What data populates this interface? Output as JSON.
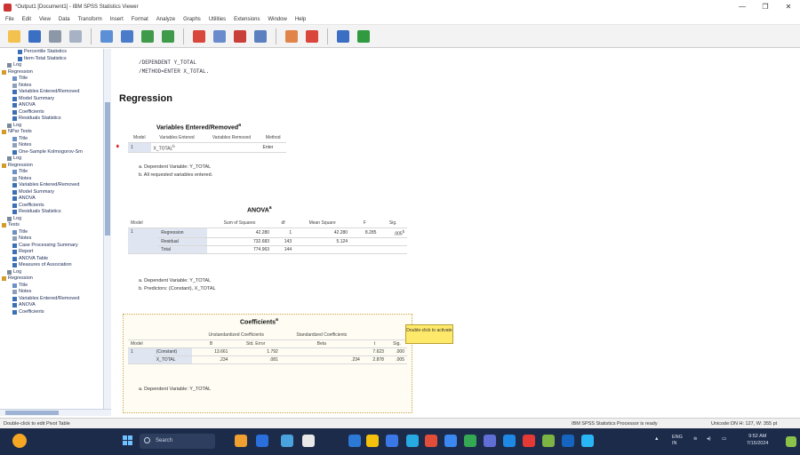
{
  "window": {
    "title": "*Output1 [Document1] - IBM SPSS Statistics Viewer",
    "controls": [
      "—",
      "❐",
      "✕"
    ]
  },
  "menu": [
    "File",
    "Edit",
    "View",
    "Data",
    "Transform",
    "Insert",
    "Format",
    "Analyze",
    "Graphs",
    "Utilities",
    "Extensions",
    "Window",
    "Help"
  ],
  "toolbar_icons": [
    "open-icon",
    "save-icon",
    "print-icon",
    "print-preview-icon",
    "export-icon",
    "recall-dialog-icon",
    "undo-icon",
    "redo-icon",
    "goto-data-icon",
    "goto-case-icon",
    "goto-variable-icon",
    "variables-icon",
    "designate-window-icon",
    "insert-output-icon",
    "promote-icon",
    "demote-icon",
    "collapse-icon",
    "expand-icon"
  ],
  "outline": {
    "nodes": [
      {
        "label": "Percentile Statistics",
        "indent": 3,
        "icon": "table"
      },
      {
        "label": "Item-Total Statistics",
        "indent": 3,
        "icon": "table"
      },
      {
        "label": "Log",
        "indent": 1,
        "icon": "log"
      },
      {
        "label": "Regression",
        "indent": 0,
        "icon": "book"
      },
      {
        "label": "Title",
        "indent": 2,
        "icon": "title"
      },
      {
        "label": "Notes",
        "indent": 2,
        "icon": "notes"
      },
      {
        "label": "Variables Entered/Removed",
        "indent": 2,
        "icon": "table"
      },
      {
        "label": "Model Summary",
        "indent": 2,
        "icon": "table"
      },
      {
        "label": "ANOVA",
        "indent": 2,
        "icon": "table"
      },
      {
        "label": "Coefficients",
        "indent": 2,
        "icon": "table"
      },
      {
        "label": "Residuals Statistics",
        "indent": 2,
        "icon": "table"
      },
      {
        "label": "Log",
        "indent": 1,
        "icon": "log"
      },
      {
        "label": "NPar Tests",
        "indent": 0,
        "icon": "book"
      },
      {
        "label": "Title",
        "indent": 2,
        "icon": "title"
      },
      {
        "label": "Notes",
        "indent": 2,
        "icon": "notes"
      },
      {
        "label": "One-Sample Kolmogorov-Sm",
        "indent": 2,
        "icon": "table"
      },
      {
        "label": "Log",
        "indent": 1,
        "icon": "log"
      },
      {
        "label": "Regression",
        "indent": 0,
        "icon": "book"
      },
      {
        "label": "Title",
        "indent": 2,
        "icon": "title"
      },
      {
        "label": "Notes",
        "indent": 2,
        "icon": "notes"
      },
      {
        "label": "Variables Entered/Removed",
        "indent": 2,
        "icon": "table"
      },
      {
        "label": "Model Summary",
        "indent": 2,
        "icon": "table"
      },
      {
        "label": "ANOVA",
        "indent": 2,
        "icon": "table"
      },
      {
        "label": "Coefficients",
        "indent": 2,
        "icon": "table"
      },
      {
        "label": "Residuals Statistics",
        "indent": 2,
        "icon": "table"
      },
      {
        "label": "Log",
        "indent": 1,
        "icon": "log"
      },
      {
        "label": "Tests",
        "indent": 0,
        "icon": "book"
      },
      {
        "label": "Title",
        "indent": 2,
        "icon": "title"
      },
      {
        "label": "Notes",
        "indent": 2,
        "icon": "notes"
      },
      {
        "label": "Case Processing Summary",
        "indent": 2,
        "icon": "table"
      },
      {
        "label": "Report",
        "indent": 2,
        "icon": "table"
      },
      {
        "label": "ANOVA Table",
        "indent": 2,
        "icon": "table"
      },
      {
        "label": "Measures of Association",
        "indent": 2,
        "icon": "table"
      },
      {
        "label": "Log",
        "indent": 1,
        "icon": "log"
      },
      {
        "label": "Regression",
        "indent": 0,
        "icon": "book"
      },
      {
        "label": "Title",
        "indent": 2,
        "icon": "title"
      },
      {
        "label": "Notes",
        "indent": 2,
        "icon": "notes"
      },
      {
        "label": "Variables Entered/Removed",
        "indent": 2,
        "icon": "table"
      },
      {
        "label": "ANOVA",
        "indent": 2,
        "icon": "table"
      },
      {
        "label": "Coefficients",
        "indent": 2,
        "icon": "table"
      }
    ]
  },
  "syntax": {
    "line1": "/DEPENDENT Y_TOTAL",
    "line2": "/METHOD=ENTER X_TOTAL."
  },
  "heading": "Regression",
  "vars_table": {
    "title": "Variables Entered/Removed",
    "title_sup": "a",
    "h_model": "Model",
    "h_entered": "Variables Entered",
    "h_removed": "Variables Removed",
    "h_method": "Method",
    "row_model": "1",
    "row_entered": "X_TOTAL",
    "row_entered_sup": "b",
    "row_removed": "",
    "row_method": "Enter",
    "foot_a": "a. Dependent Variable: Y_TOTAL",
    "foot_b": "b. All requested variables entered."
  },
  "anova_table": {
    "title": "ANOVA",
    "title_sup": "a",
    "h_model": "Model",
    "h_ss": "Sum of Squares",
    "h_df": "df",
    "h_ms": "Mean Square",
    "h_f": "F",
    "h_sig": "Sig.",
    "model_num": "1",
    "rows": [
      {
        "label": "Regression",
        "ss": "42.280",
        "df": "1",
        "ms": "42.280",
        "f": "8.285",
        "sig": ".005",
        "sig_sup": "b"
      },
      {
        "label": "Residual",
        "ss": "732.683",
        "df": "143",
        "ms": "5.124",
        "f": "",
        "sig": "",
        "sig_sup": ""
      },
      {
        "label": "Total",
        "ss": "774.963",
        "df": "144",
        "ms": "",
        "f": "",
        "sig": "",
        "sig_sup": ""
      }
    ],
    "foot_a": "a. Dependent Variable: Y_TOTAL",
    "foot_b": "b. Predictors: (Constant), X_TOTAL"
  },
  "coef_table": {
    "title": "Coefficients",
    "title_sup": "a",
    "h_model": "Model",
    "h_unstd": "Unstandardized Coefficients",
    "h_std": "Standardized Coefficients",
    "h_b": "B",
    "h_se": "Std. Error",
    "h_beta": "Beta",
    "h_t": "t",
    "h_sig": "Sig.",
    "model_num": "1",
    "rows": [
      {
        "label": "(Constant)",
        "b": "13.661",
        "se": "1.792",
        "beta": "",
        "t": "7.623",
        "sig": ".000"
      },
      {
        "label": "X_TOTAL",
        "b": ".234",
        "se": ".081",
        "beta": ".234",
        "t": "2.878",
        "sig": ".005"
      }
    ],
    "foot_a": "a. Dependent Variable: Y_TOTAL"
  },
  "tooltip": "Double-click to activate",
  "status": {
    "left": "Double-click to edit Pivot Table",
    "processor": "IBM SPSS Statistics Processor is ready",
    "unicode": "Unicode:ON  H: 127, W: 355 pt"
  },
  "taskbar": {
    "search_placeholder": "Search",
    "tray_lang": "ENG",
    "tray_lang2": "IN",
    "time": "9:52 AM",
    "date": "7/15/2024"
  },
  "colors": {
    "outline_row_bg": "#dfe6f1",
    "taskbar": "#1c2b4a",
    "tooltip": "#ffe96b"
  }
}
